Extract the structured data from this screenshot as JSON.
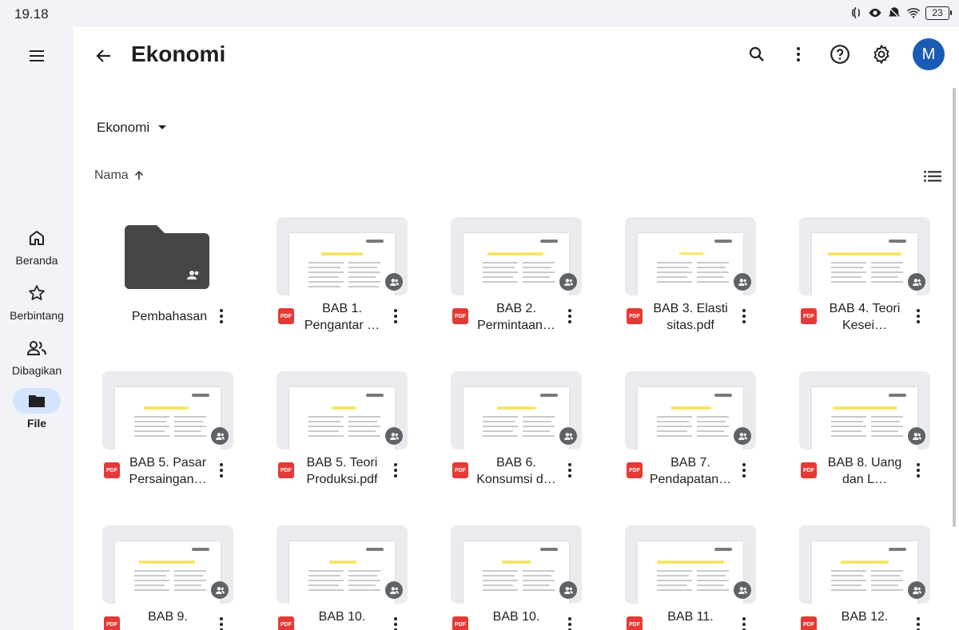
{
  "status_bar": {
    "time": "19.18",
    "battery": "23"
  },
  "nav": {
    "items": [
      {
        "label": "Beranda",
        "icon": "home-icon"
      },
      {
        "label": "Berbintang",
        "icon": "star-icon"
      },
      {
        "label": "Dibagikan",
        "icon": "people-icon"
      },
      {
        "label": "File",
        "icon": "folder-icon",
        "active": true
      }
    ]
  },
  "header": {
    "title": "Ekonomi",
    "avatar_initial": "M"
  },
  "breadcrumb": {
    "current": "Ekonomi"
  },
  "sort": {
    "label": "Nama",
    "direction": "ascending"
  },
  "colors": {
    "accent": "#1a5bb5",
    "rail_bg": "#f1f3f8",
    "active_pill": "#d3e3fd",
    "pdf_red": "#e53935"
  },
  "files": [
    {
      "name": "Pembahasan",
      "type": "folder",
      "shared": true
    },
    {
      "name": "BAB 1. Pengantar …",
      "type": "pdf",
      "shared": true,
      "badge": "PDF"
    },
    {
      "name": "BAB 2. Permintaan…",
      "type": "pdf",
      "shared": true,
      "badge": "PDF"
    },
    {
      "name": "BAB 3. Elasti sitas.pdf",
      "type": "pdf",
      "shared": true,
      "badge": "PDF"
    },
    {
      "name": "BAB 4. Teori Kesei…",
      "type": "pdf",
      "shared": true,
      "badge": "PDF"
    },
    {
      "name": "BAB 5. Pasar Persaingan…",
      "type": "pdf",
      "shared": true,
      "badge": "PDF"
    },
    {
      "name": "BAB 5. Teori Produksi.pdf",
      "type": "pdf",
      "shared": true,
      "badge": "PDF"
    },
    {
      "name": "BAB 6. Konsumsi d…",
      "type": "pdf",
      "shared": true,
      "badge": "PDF"
    },
    {
      "name": "BAB 7. Pendapatan…",
      "type": "pdf",
      "shared": true,
      "badge": "PDF"
    },
    {
      "name": "BAB 8. Uang dan L…",
      "type": "pdf",
      "shared": true,
      "badge": "PDF"
    },
    {
      "name": "BAB 9.",
      "type": "pdf",
      "shared": true,
      "badge": "PDF"
    },
    {
      "name": "BAB 10.",
      "type": "pdf",
      "shared": true,
      "badge": "PDF"
    },
    {
      "name": "BAB 10.",
      "type": "pdf",
      "shared": true,
      "badge": "PDF"
    },
    {
      "name": "BAB 11.",
      "type": "pdf",
      "shared": true,
      "badge": "PDF"
    },
    {
      "name": "BAB 12.",
      "type": "pdf",
      "shared": true,
      "badge": "PDF"
    }
  ]
}
